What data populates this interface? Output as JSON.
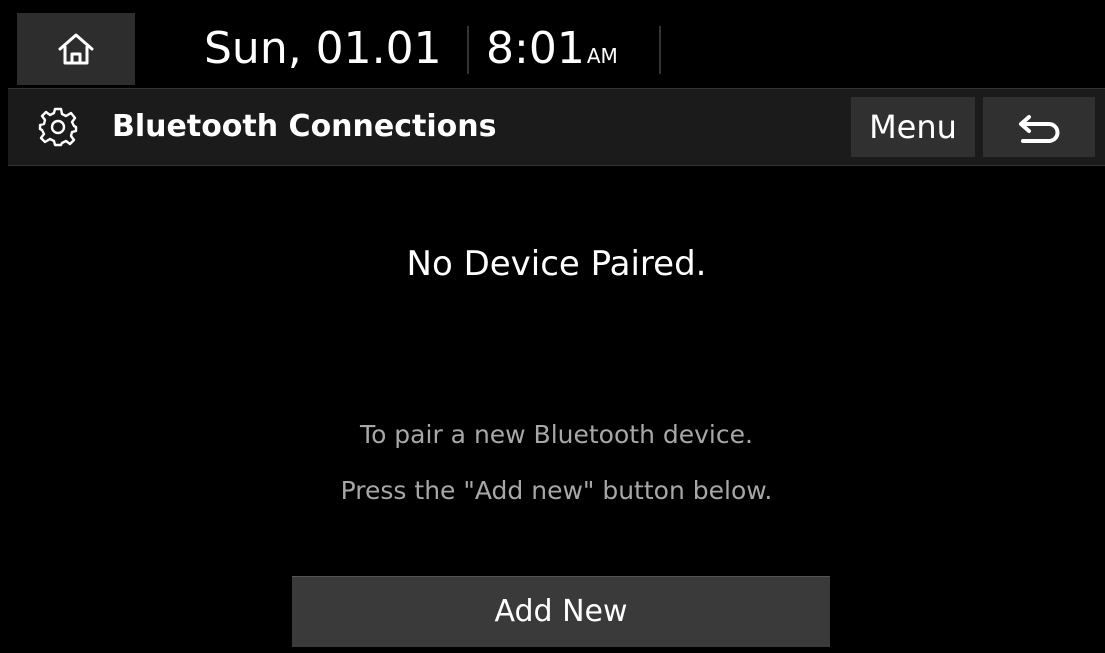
{
  "status_bar": {
    "home_icon": "home-icon",
    "date": "Sun, 01.01",
    "time": "8:01",
    "ampm": "AM"
  },
  "header": {
    "icon": "gear-icon",
    "title": "Bluetooth Connections",
    "menu_label": "Menu",
    "back_icon": "back-arrow-icon"
  },
  "main": {
    "message": "No Device Paired.",
    "hint_line1": "To pair a new Bluetooth device.",
    "hint_line2": "Press the \"Add new\" button below.",
    "add_button_label": "Add New"
  },
  "colors": {
    "background": "#000000",
    "header_bar": "#1b1b1b",
    "button": "#303030",
    "hint_text": "#a7a7a7"
  }
}
